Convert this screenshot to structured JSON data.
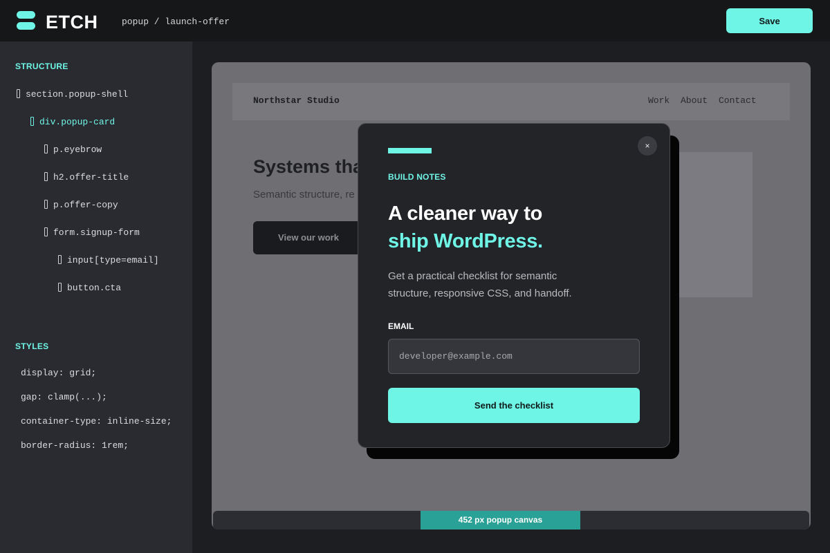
{
  "app": {
    "logo_text": "ETCH",
    "icon": "etch-logo-icon"
  },
  "breadcrumb": "popup / launch-offer",
  "toolbar": {
    "save_label": "Save"
  },
  "colors": {
    "accent": "#6ff5e6",
    "background": "#1d1e22",
    "panel": "#2a2b30"
  },
  "sidebar": {
    "structure_heading": "STRUCTURE",
    "tree": [
      "section.popup-shell",
      "div.popup-card",
      "p.eyebrow",
      "h2.offer-title",
      "p.offer-copy",
      "form.signup-form",
      "input[type=email]",
      "button.cta"
    ],
    "styles_heading": "STYLES",
    "styles": [
      "display: grid;",
      "gap: clamp(...);",
      "container-type: inline-size;",
      "border-radius: 1rem;"
    ]
  },
  "preview": {
    "site_name": "Northstar Studio",
    "nav": [
      "Work",
      "About",
      "Contact"
    ],
    "hero_title": "Systems tha",
    "hero_copy": "Semantic structure, re",
    "hero_button": "View our work",
    "canvas_width_label": "452 px popup canvas"
  },
  "popup": {
    "close_label": "×",
    "eyebrow": "BUILD NOTES",
    "title_line1": "A cleaner way to",
    "title_line2": "ship WordPress.",
    "copy": "Get a practical checklist for semantic structure, responsive CSS, and handoff.",
    "email_label": "EMAIL",
    "email_placeholder": "developer@example.com",
    "cta_label": "Send the checklist"
  }
}
